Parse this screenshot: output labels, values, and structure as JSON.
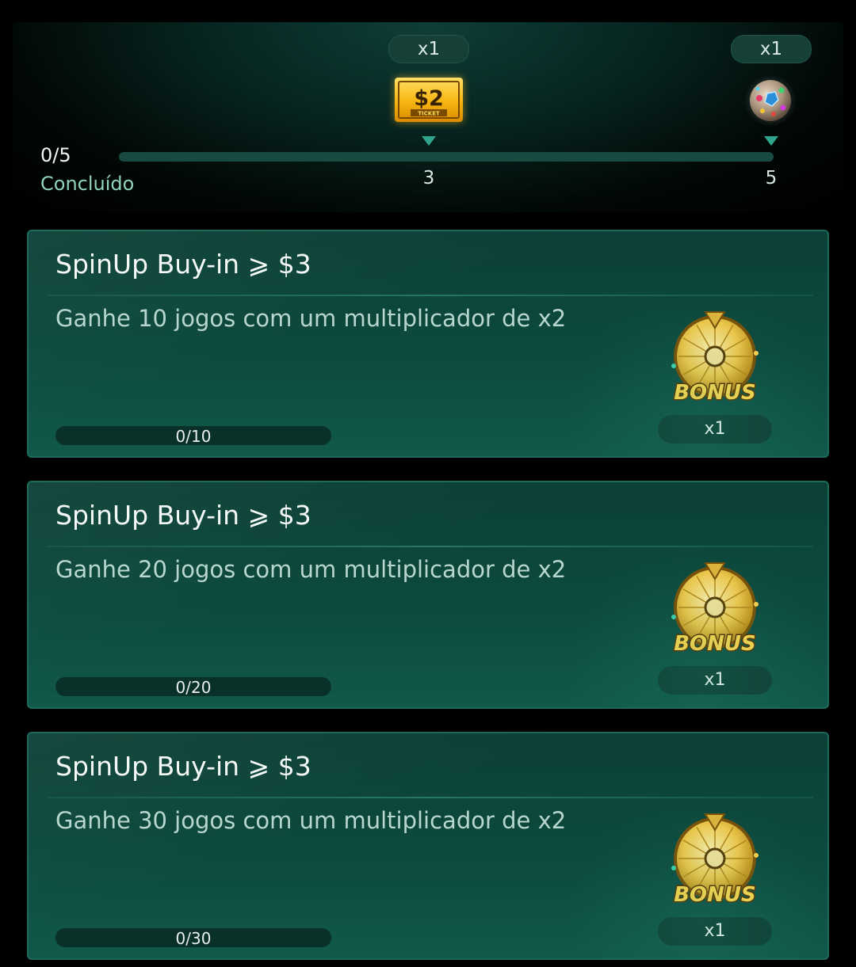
{
  "milestones": {
    "progress_count": "0/5",
    "progress_label": "Concluído",
    "progress_fraction": 0,
    "rewards": [
      {
        "threshold": "3",
        "quantity": "x1",
        "icon": "ticket-icon",
        "ticket_amount": "$2",
        "ticket_label": "TICKET"
      },
      {
        "threshold": "5",
        "quantity": "x1",
        "icon": "gem-orb-icon"
      }
    ]
  },
  "tasks": [
    {
      "title": "SpinUp Buy-in ⩾ $3",
      "description": "Ganhe 10 jogos com um multiplicador de x2",
      "progress": "0/10",
      "reward_icon": "bonus-wheel-icon",
      "reward_label": "BONUS",
      "reward_quantity": "x1"
    },
    {
      "title": "SpinUp Buy-in ⩾ $3",
      "description": "Ganhe 20 jogos com um multiplicador de x2",
      "progress": "0/20",
      "reward_icon": "bonus-wheel-icon",
      "reward_label": "BONUS",
      "reward_quantity": "x1"
    },
    {
      "title": "SpinUp Buy-in ⩾ $3",
      "description": "Ganhe 30 jogos com um multiplicador de x2",
      "progress": "0/30",
      "reward_icon": "bonus-wheel-icon",
      "reward_label": "BONUS",
      "reward_quantity": "x1"
    }
  ],
  "colors": {
    "background": "#000000",
    "card": "#0d4a3e",
    "accent": "#2ea58c",
    "label_teal": "#8fd2bf",
    "ticket_gold": "#f6b511"
  }
}
